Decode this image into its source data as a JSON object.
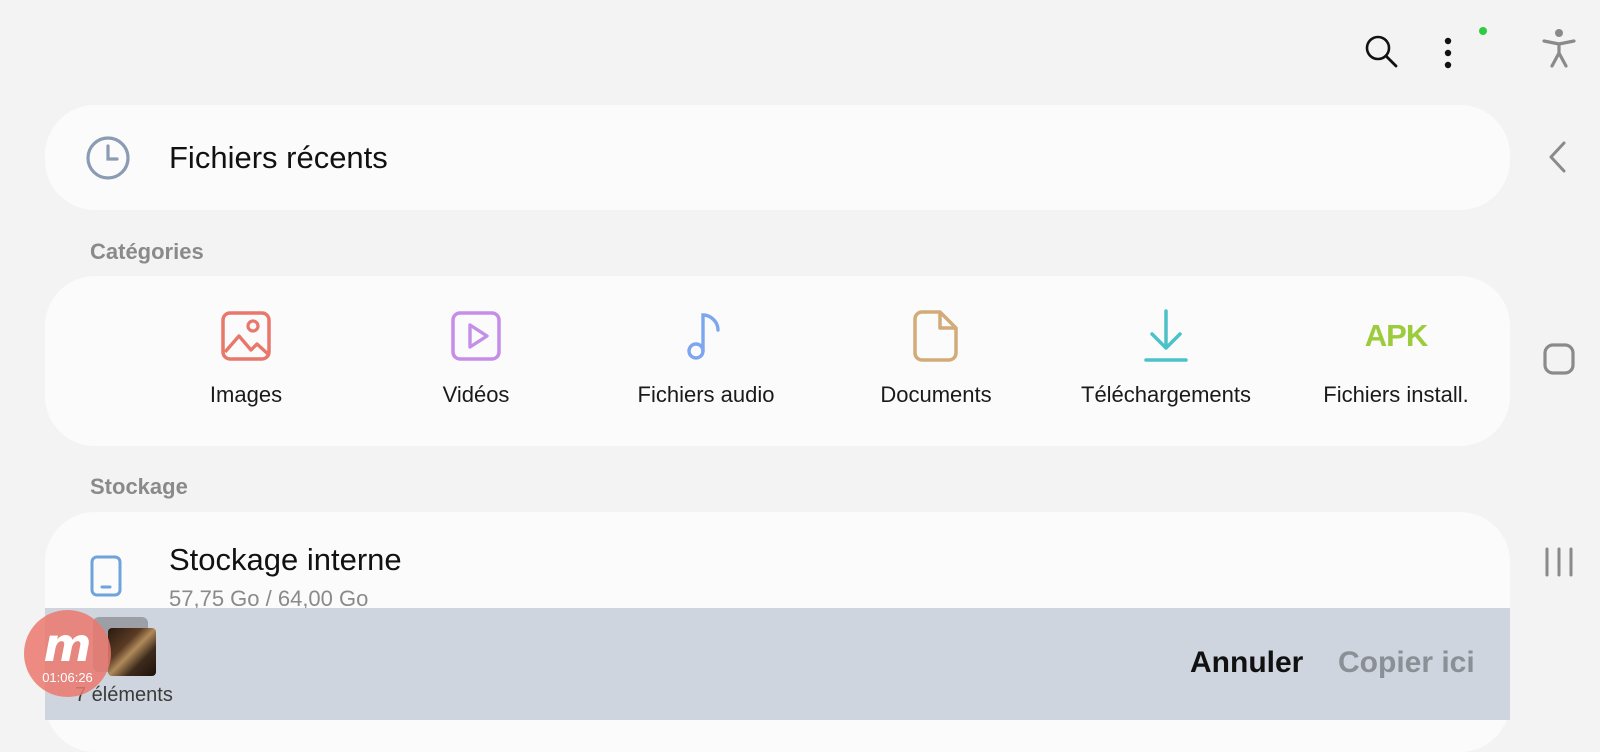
{
  "header": {
    "search_icon": "search-icon",
    "more_icon": "more-vertical-icon",
    "status_dot_color": "#2ecc40"
  },
  "recent": {
    "label": "Fichiers récents",
    "icon": "clock-icon"
  },
  "categories": {
    "title": "Catégories",
    "items": [
      {
        "label": "Images",
        "icon": "image-icon",
        "color": "#e8786c"
      },
      {
        "label": "Vidéos",
        "icon": "video-icon",
        "color": "#c58ee8"
      },
      {
        "label": "Fichiers audio",
        "icon": "music-note-icon",
        "color": "#7ea6ef"
      },
      {
        "label": "Documents",
        "icon": "document-icon",
        "color": "#d2ab78"
      },
      {
        "label": "Téléchargements",
        "icon": "download-icon",
        "color": "#4cc2c8"
      },
      {
        "label": "Fichiers install.",
        "icon": "apk-icon",
        "icon_text": "APK",
        "color": "#9ccb3c"
      }
    ]
  },
  "storage": {
    "title": "Stockage",
    "items": [
      {
        "label": "Stockage interne",
        "usage": "57,75 Go / 64,00 Go",
        "icon": "phone-icon"
      }
    ]
  },
  "clipboard": {
    "count_label": "7 éléments",
    "cancel_label": "Annuler",
    "paste_label": "Copier ici"
  },
  "recorder": {
    "time": "01:06:26",
    "letter": "m"
  },
  "side_nav": [
    "accessibility-icon",
    "back-icon",
    "home-icon",
    "recent-apps-icon"
  ]
}
